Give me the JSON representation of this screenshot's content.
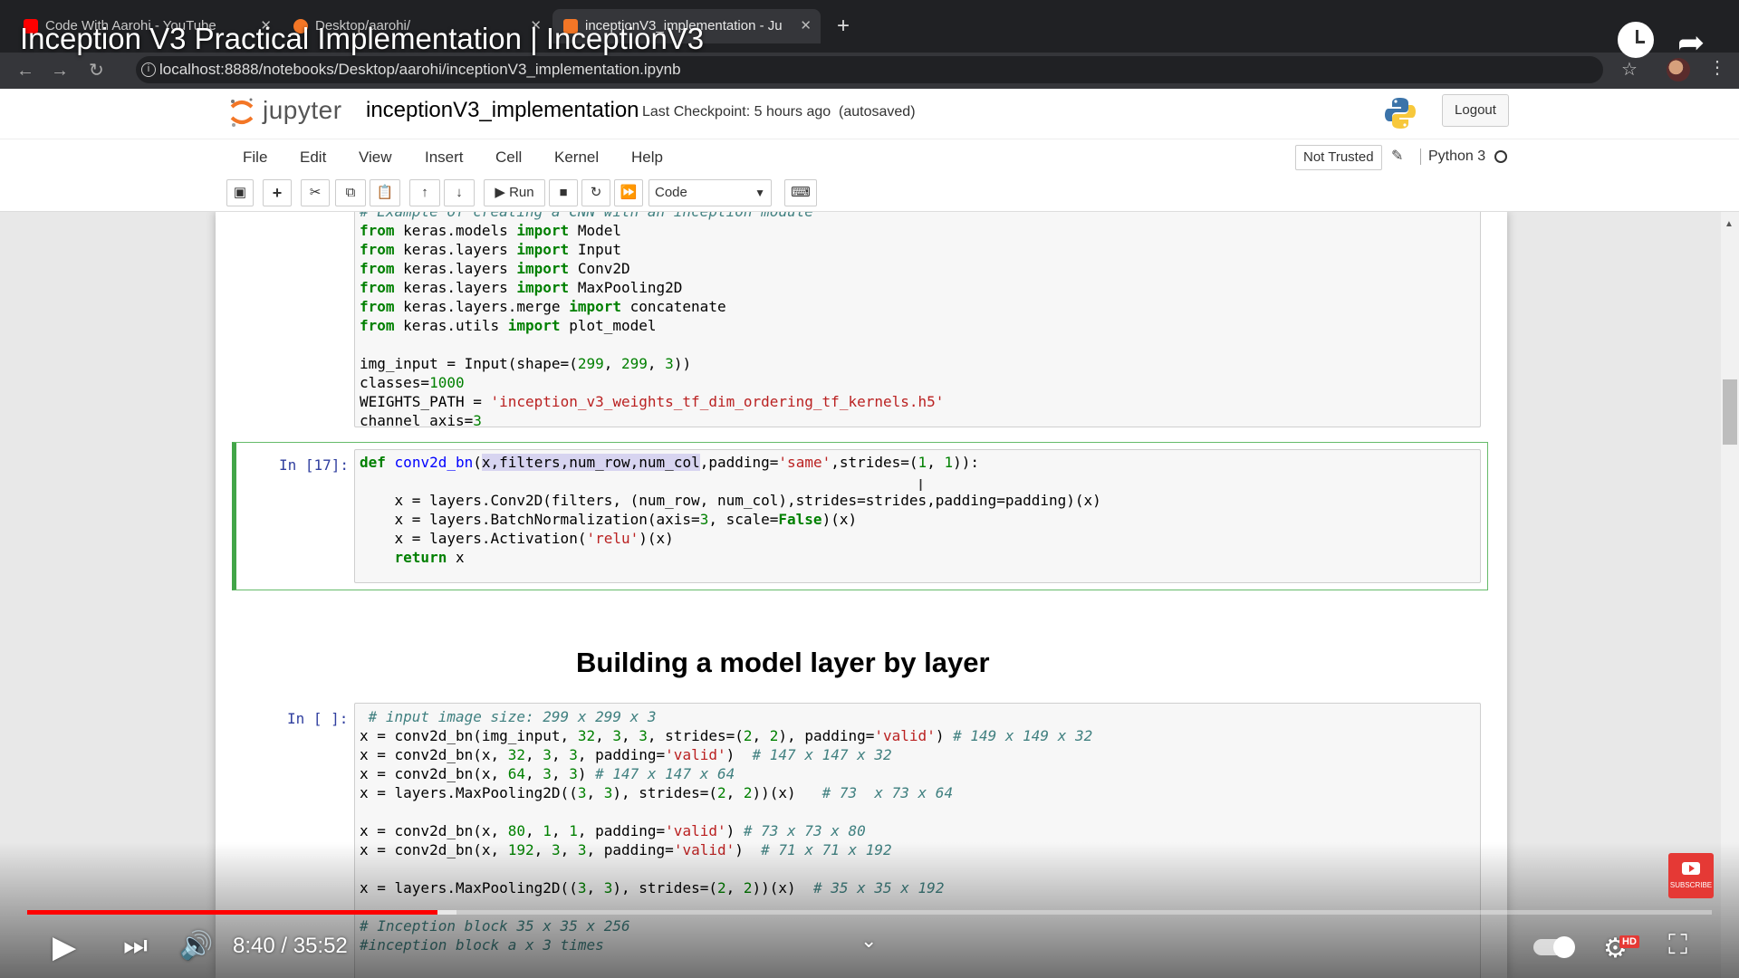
{
  "browser": {
    "tabs": [
      {
        "label": "Code With Aarohi - YouTube",
        "active": false,
        "favicon_color": "#ff0000"
      },
      {
        "label": "Desktop/aarohi/",
        "active": false,
        "favicon_color": "#f37626"
      },
      {
        "label": "inceptionV3_implementation - Ju",
        "active": true,
        "favicon_color": "#f37626"
      }
    ],
    "url": "localhost:8888/notebooks/Desktop/aarohi/inceptionV3_implementation.ipynb"
  },
  "video": {
    "title": "Inception V3 Practical Implementation | InceptionV3",
    "time": "8:40 / 35:52",
    "progress_fraction": 0.2435,
    "buffered_fraction": 0.255,
    "subscribe_label": "SUBSCRIBE",
    "hd_label": "HD"
  },
  "jupyter": {
    "logo_text": "jupyter",
    "notebook_name": "inceptionV3_implementation",
    "checkpoint": "Last Checkpoint: 5 hours ago",
    "autosave": "(autosaved)",
    "logout": "Logout",
    "menu": [
      "File",
      "Edit",
      "View",
      "Insert",
      "Cell",
      "Kernel",
      "Help"
    ],
    "trust": "Not Trusted",
    "kernel": "Python 3",
    "run_label": "Run",
    "cell_type": "Code"
  },
  "cells": {
    "cell1_partial_comment": "# Example of creating a CNN with an inception module",
    "cell2_prompt": "In [17]:",
    "cell3_prompt": "In [ ]:",
    "heading": "Building a model layer by layer"
  },
  "colors": {
    "keyword": "#008000",
    "string": "#ba2121",
    "comment": "#408080",
    "prompt": "#303f9f",
    "selected_cell_border": "#42a548",
    "progress_red": "#ff0000"
  }
}
